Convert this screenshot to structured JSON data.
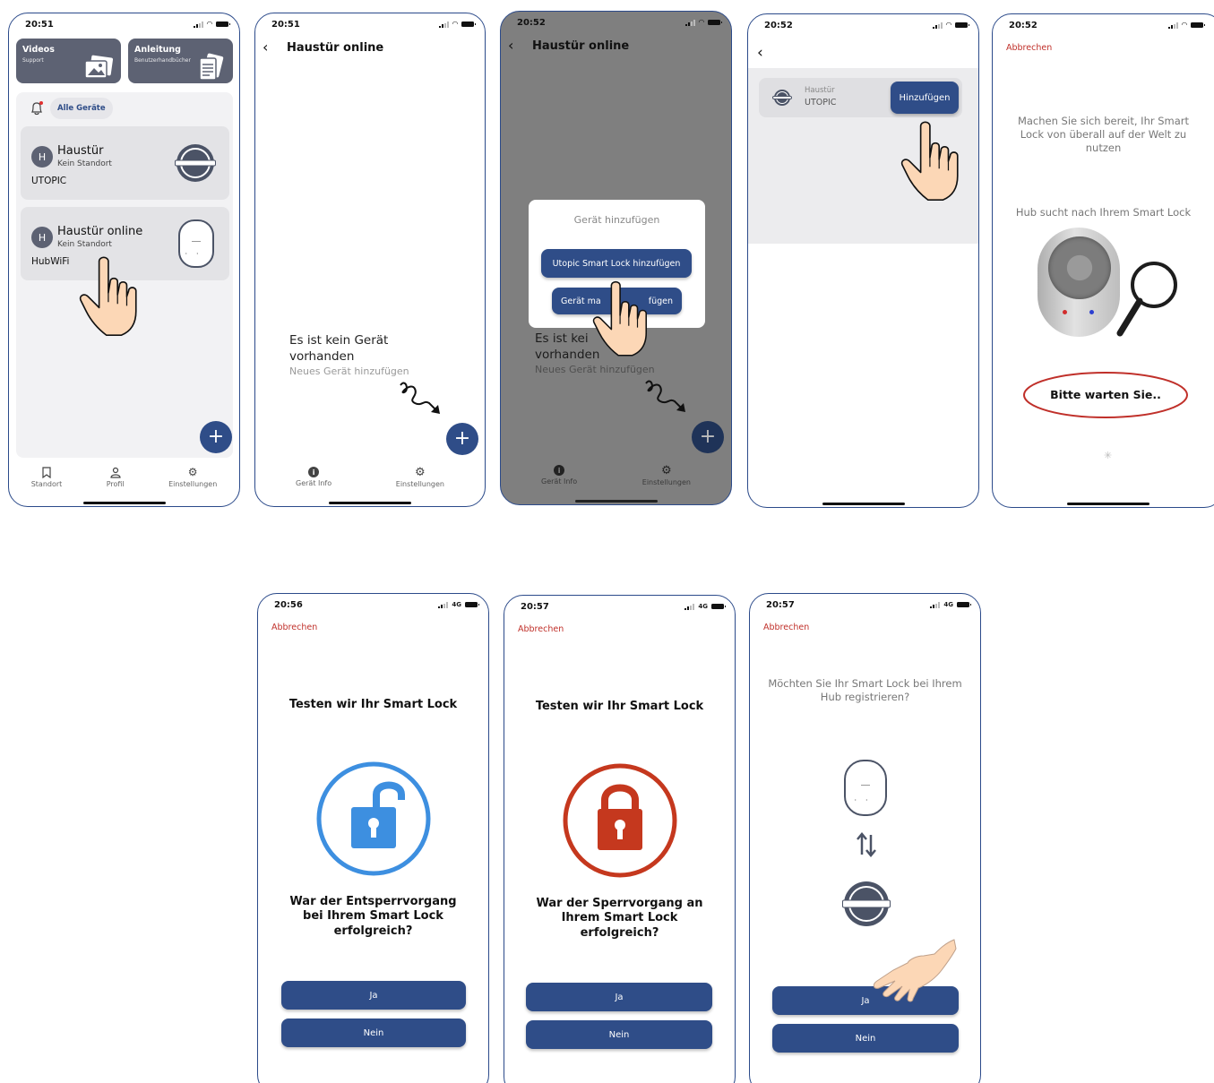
{
  "colors": {
    "primary": "#2f4d88",
    "cancel": "#c0302a",
    "unlock": "#3d8fe0",
    "lock": "#c5381e",
    "border": "#2b4a8a"
  },
  "s1": {
    "time": "20:51",
    "cards": [
      {
        "title": "Videos",
        "subtitle": "Support"
      },
      {
        "title": "Anleitung",
        "subtitle": "Benutzerhandbücher"
      }
    ],
    "filter": "Alle Geräte",
    "devices": [
      {
        "avatar": "H",
        "name": "Haustür",
        "location": "Kein Standort",
        "model": "UTOPIC"
      },
      {
        "avatar": "H",
        "name": "Haustür online",
        "location": "Kein Standort",
        "model": "HubWiFi"
      }
    ],
    "fab": "+",
    "tabs": [
      "Standort",
      "Profil",
      "Einstellungen"
    ]
  },
  "s2": {
    "time": "20:51",
    "header": "Haustür online",
    "empty_line1": "Es ist kein Gerät",
    "empty_line2": "vorhanden",
    "empty_hint": "Neues Gerät hinzufügen",
    "fab": "+",
    "tabs": [
      "Gerät Info",
      "Einstellungen"
    ]
  },
  "s3": {
    "time": "20:52",
    "header": "Haustür online",
    "modal_title": "Gerät hinzufügen",
    "btn1": "Utopic Smart Lock hinzufügen",
    "btn2_left": "Gerät ma",
    "btn2_right": "fügen",
    "empty_line1": "Es ist kei",
    "empty_line2": "vorhanden",
    "empty_hint": "Neues Gerät hinzufügen",
    "fab": "+",
    "tabs": [
      "Gerät Info",
      "Einstellungen"
    ]
  },
  "s4": {
    "time": "20:52",
    "device_name": "Haustür",
    "device_model": "UTOPIC",
    "add_button": "Hinzufügen"
  },
  "s5": {
    "time": "20:52",
    "cancel": "Abbrechen",
    "message": "Machen Sie sich bereit, Ihr Smart Lock von überall auf der Welt zu nutzen",
    "searching": "Hub sucht nach Ihrem Smart Lock",
    "wait": "Bitte warten Sie.."
  },
  "s6": {
    "time": "20:56",
    "network": "4G",
    "cancel": "Abbrechen",
    "title": "Testen wir Ihr Smart Lock",
    "question": "War der Entsperrvorgang bei Ihrem Smart Lock erfolgreich?",
    "yes": "Ja",
    "no": "Nein"
  },
  "s7": {
    "time": "20:57",
    "network": "4G",
    "cancel": "Abbrechen",
    "title": "Testen wir Ihr Smart Lock",
    "question": "War der Sperrvorgang an Ihrem Smart Lock erfolgreich?",
    "yes": "Ja",
    "no": "Nein"
  },
  "s8": {
    "time": "20:57",
    "network": "4G",
    "cancel": "Abbrechen",
    "question": "Möchten Sie Ihr Smart Lock bei Ihrem Hub registrieren?",
    "yes": "Ja",
    "no": "Nein"
  }
}
